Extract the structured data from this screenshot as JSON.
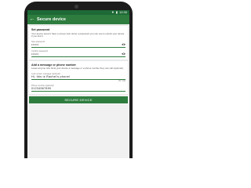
{
  "statusbar": {
    "signal": "▼",
    "battery": "▮",
    "time": "12:30"
  },
  "appbar": {
    "back_icon": "←",
    "title": "Secure device"
  },
  "password_section": {
    "title": "Set password",
    "description": "Your device doesn't have a screen lock. Enter a password you can use to unlock your device if you find it.",
    "new_password": {
      "label": "New password",
      "value": "••••••"
    },
    "confirm_password": {
      "label": "Confirm password",
      "value": "••••••"
    }
  },
  "message_section": {
    "title": "Add a message or phone number",
    "description": "Leave anyone who finds your device a message or a phone number they can call (optional).",
    "message": {
      "label": "Lock screen message (optional)",
      "value": "Hi, this is Rachel's phone!",
      "counter": "25 / 100"
    },
    "phone": {
      "label": "Phone number (optional)",
      "value": "01234567890"
    }
  },
  "secure_button_label": "SECURE DEVICE",
  "colors": {
    "primary": "#2e7d3f",
    "statusbar": "#1e6a36"
  }
}
